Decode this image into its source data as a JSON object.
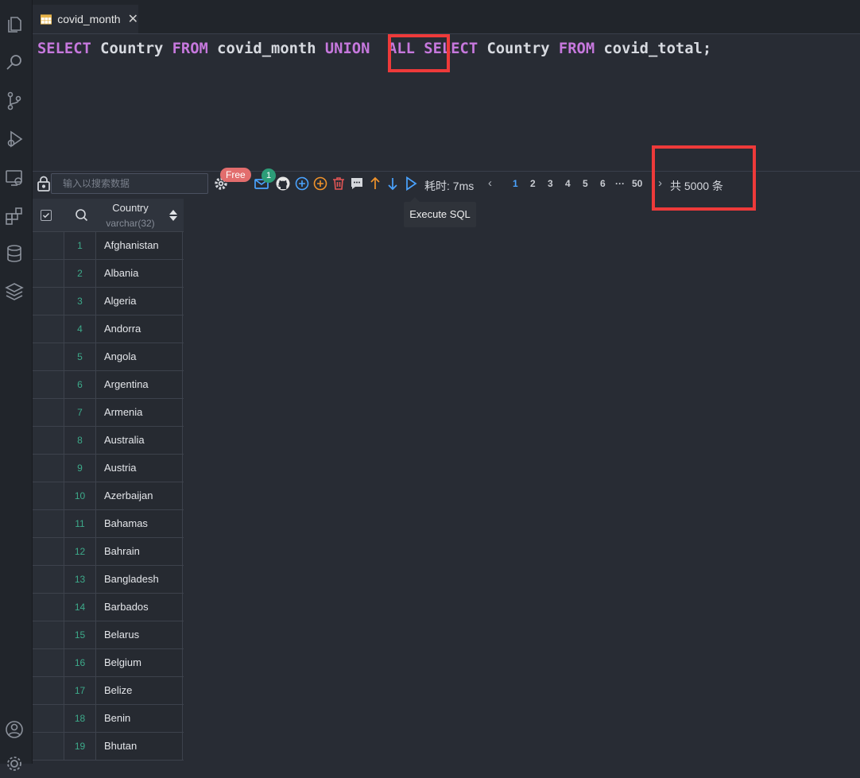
{
  "tab": {
    "title": "covid_month",
    "close": "✕"
  },
  "editor": {
    "tokens": [
      "SELECT",
      "Country",
      "FROM",
      "covid_month",
      "UNION",
      "ALL",
      "SELECT",
      "Country",
      "FROM",
      "covid_total;"
    ]
  },
  "toolbar": {
    "search_placeholder": "输入以搜索数据",
    "free_badge": "Free",
    "notification_count": "1",
    "elapsed": "耗时: 7ms",
    "pages": [
      "1",
      "2",
      "3",
      "4",
      "5",
      "6",
      "···",
      "50"
    ],
    "active_page": "1",
    "prev": "‹",
    "next": "›",
    "total": "共 5000 条",
    "run_tooltip": "Execute SQL"
  },
  "table": {
    "column_name": "Country",
    "column_type": "varchar(32)",
    "rows": [
      {
        "n": "1",
        "country": "Afghanistan"
      },
      {
        "n": "2",
        "country": "Albania"
      },
      {
        "n": "3",
        "country": "Algeria"
      },
      {
        "n": "4",
        "country": "Andorra"
      },
      {
        "n": "5",
        "country": "Angola"
      },
      {
        "n": "6",
        "country": "Argentina"
      },
      {
        "n": "7",
        "country": "Armenia"
      },
      {
        "n": "8",
        "country": "Australia"
      },
      {
        "n": "9",
        "country": "Austria"
      },
      {
        "n": "10",
        "country": "Azerbaijan"
      },
      {
        "n": "11",
        "country": "Bahamas"
      },
      {
        "n": "12",
        "country": "Bahrain"
      },
      {
        "n": "13",
        "country": "Bangladesh"
      },
      {
        "n": "14",
        "country": "Barbados"
      },
      {
        "n": "15",
        "country": "Belarus"
      },
      {
        "n": "16",
        "country": "Belgium"
      },
      {
        "n": "17",
        "country": "Belize"
      },
      {
        "n": "18",
        "country": "Benin"
      },
      {
        "n": "19",
        "country": "Bhutan"
      }
    ]
  },
  "colors": {
    "keyword": "#c678dd",
    "annotation": "#ee3a3a",
    "row_number": "#3daa8a",
    "active_page": "#4aa3ff"
  }
}
